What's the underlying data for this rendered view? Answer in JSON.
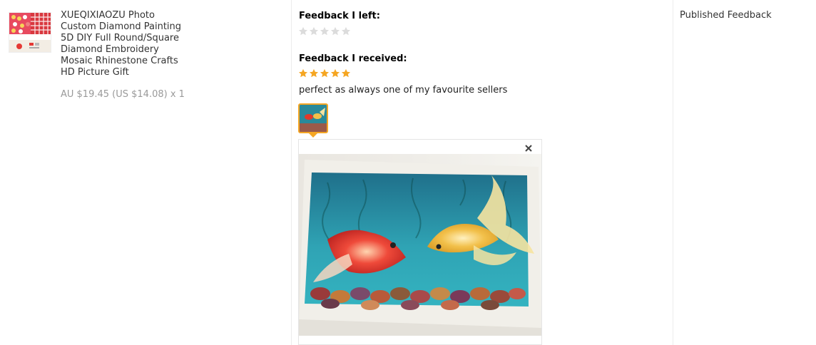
{
  "product": {
    "title_lines": [
      "XUEQIXIAOZU Photo",
      "Custom Diamond Painting",
      "5D DIY Full Round/Square",
      "Diamond Embroidery",
      "Mosaic Rhinestone Crafts",
      "HD Picture Gift"
    ],
    "price": "AU $19.45 (US $14.08) x 1",
    "thumbnail_icon": "product-thumbnail-image"
  },
  "feedback": {
    "left_label": "Feedback I left:",
    "left_rating": 0,
    "received_label": "Feedback I received:",
    "received_rating": 5,
    "comment": "perfect as always one of my favourite sellers",
    "star_color_filled": "#f5a623",
    "star_color_empty": "#dcdcdc",
    "photo_icon": "feedback-photo-thumbnail",
    "close_icon": "close-icon"
  },
  "status": {
    "label": "Published Feedback"
  }
}
